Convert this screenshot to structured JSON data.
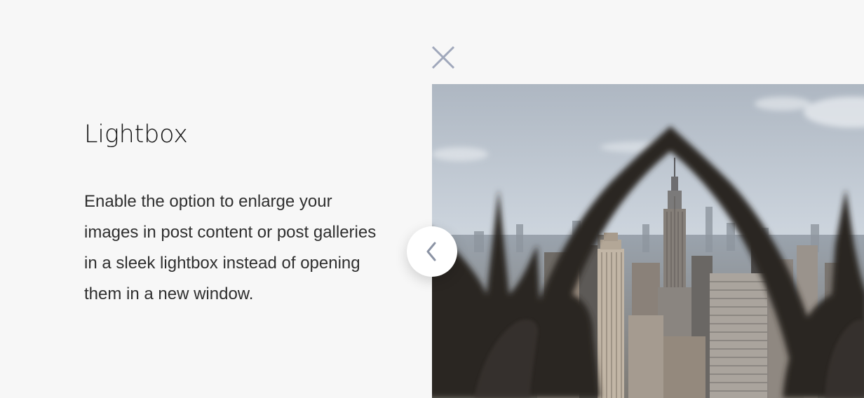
{
  "feature": {
    "title": "Lightbox",
    "description": "Enable the option to enlarge your images in post content or post galleries in a sleek lightbox instead of opening them in a new window."
  },
  "lightbox": {
    "close_icon": "close-icon",
    "prev_icon": "chevron-left-icon",
    "image_subject": "city-skyline-photo"
  },
  "colors": {
    "background": "#f7f7f7",
    "close_icon": "#a0a8bb",
    "chevron": "#8b93a4",
    "title": "#141414",
    "body_text": "#2f2f2f"
  }
}
